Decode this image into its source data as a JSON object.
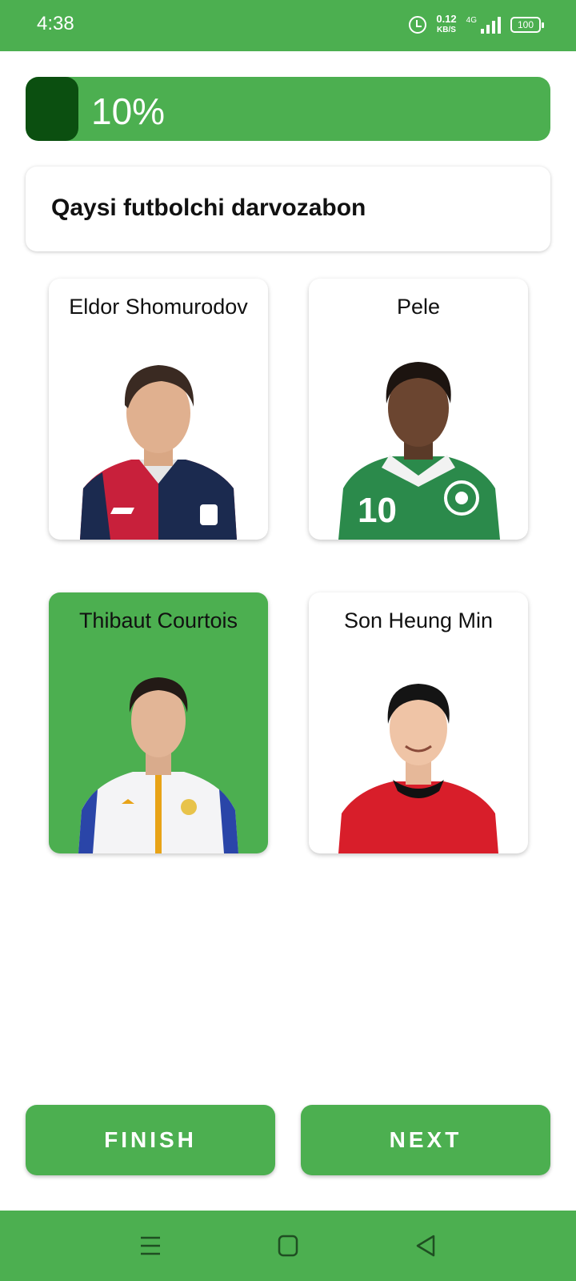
{
  "status_bar": {
    "time": "4:38",
    "speed_value": "0.12",
    "speed_unit": "KB/S",
    "network": "4G",
    "battery": "100"
  },
  "progress": {
    "label": "10%",
    "value": 0.1
  },
  "question": {
    "text": "Qaysi futbolchi darvozabon"
  },
  "options": [
    {
      "name": "Eldor Shomurodov",
      "selected": false,
      "jersey": "red-navy"
    },
    {
      "name": "Pele",
      "selected": false,
      "jersey": "green"
    },
    {
      "name": "Thibaut Courtois",
      "selected": true,
      "jersey": "white"
    },
    {
      "name": "Son Heung Min",
      "selected": false,
      "jersey": "red"
    }
  ],
  "buttons": {
    "finish": "FINISH",
    "next": "NEXT"
  },
  "nav_bar": {
    "icons": [
      "menu-icon",
      "home-icon",
      "back-icon"
    ]
  },
  "colors": {
    "accent": "#4caf50",
    "progress_fill": "#0b4f10"
  }
}
